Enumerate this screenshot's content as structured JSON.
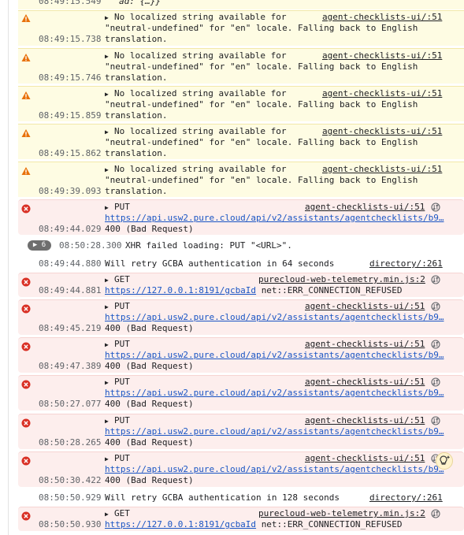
{
  "top_partial": {
    "time": "08:49:15.549",
    "text": "ad: {…}}"
  },
  "warnings": [
    {
      "time": "08:49:15.738",
      "l1": "No localized string available for",
      "l2": "\"neutral-undefined\" for \"en\" locale. Falling back to English",
      "l3": "translation.",
      "source": "agent-checklists-ui/:51"
    },
    {
      "time": "08:49:15.746",
      "l1": "No localized string available for",
      "l2": "\"neutral-undefined\" for \"en\" locale. Falling back to English",
      "l3": "translation.",
      "source": "agent-checklists-ui/:51"
    },
    {
      "time": "08:49:15.859",
      "l1": "No localized string available for",
      "l2": "\"neutral-undefined\" for \"en\" locale. Falling back to English",
      "l3": "translation.",
      "source": "agent-checklists-ui/:51"
    },
    {
      "time": "08:49:15.862",
      "l1": "No localized string available for",
      "l2": "\"neutral-undefined\" for \"en\" locale. Falling back to English",
      "l3": "translation.",
      "source": "agent-checklists-ui/:51"
    },
    {
      "time": "08:49:39.093",
      "l1": "No localized string available for",
      "l2": "\"neutral-undefined\" for \"en\" locale. Falling back to English",
      "l3": "translation.",
      "source": "agent-checklists-ui/:51"
    }
  ],
  "err1": {
    "time": "08:49:44.029",
    "method": "PUT",
    "source": "agent-checklists-ui/:51",
    "url": "https://api.usw2.pure.cloud/api/v2/assistants/agentchecklists/b9…",
    "status": "400 (Bad Request)"
  },
  "group": {
    "count": "6",
    "time": "08:50:28.300",
    "text": "XHR failed loading: PUT \"<URL>\"."
  },
  "retry1": {
    "time": "08:49:44.880",
    "text": "Will retry GCBA authentication in 64 seconds",
    "source": "directory/:261"
  },
  "get1": {
    "time": "08:49:44.881",
    "method": "GET",
    "source": "purecloud-web-telemetry.min.js:2",
    "url": "https://127.0.0.1:8191/gcbaId",
    "status": "net::ERR_CONNECTION_REFUSED"
  },
  "puts": [
    {
      "time": "08:49:45.219",
      "method": "PUT",
      "source": "agent-checklists-ui/:51",
      "url": "https://api.usw2.pure.cloud/api/v2/assistants/agentchecklists/b9…",
      "status": "400 (Bad Request)"
    },
    {
      "time": "08:49:47.389",
      "method": "PUT",
      "source": "agent-checklists-ui/:51",
      "url": "https://api.usw2.pure.cloud/api/v2/assistants/agentchecklists/b9…",
      "status": "400 (Bad Request)"
    },
    {
      "time": "08:50:27.077",
      "method": "PUT",
      "source": "agent-checklists-ui/:51",
      "url": "https://api.usw2.pure.cloud/api/v2/assistants/agentchecklists/b9…",
      "status": "400 (Bad Request)"
    },
    {
      "time": "08:50:28.265",
      "method": "PUT",
      "source": "agent-checklists-ui/:51",
      "url": "https://api.usw2.pure.cloud/api/v2/assistants/agentchecklists/b9…",
      "status": "400 (Bad Request)"
    },
    {
      "time": "08:50:30.422",
      "method": "PUT",
      "source": "agent-checklists-ui/:51",
      "url": "https://api.usw2.pure.cloud/api/v2/assistants/agentchecklists/b9…",
      "status": "400 (Bad Request)"
    }
  ],
  "retry2": {
    "time": "08:50:50.929",
    "text": "Will retry GCBA authentication in 128 seconds",
    "source": "directory/:261"
  },
  "get2": {
    "time": "08:50:50.930",
    "method": "GET",
    "source": "purecloud-web-telemetry.min.js:2",
    "url": "https://127.0.0.1:8191/gcbaId",
    "status": "net::ERR_CONNECTION_REFUSED"
  },
  "colors": {
    "warning_bg": "#fefce3",
    "error_bg": "#fdeeed",
    "warning_icon": "#e8710a",
    "error_icon": "#d93025",
    "link": "#1a55c4"
  }
}
